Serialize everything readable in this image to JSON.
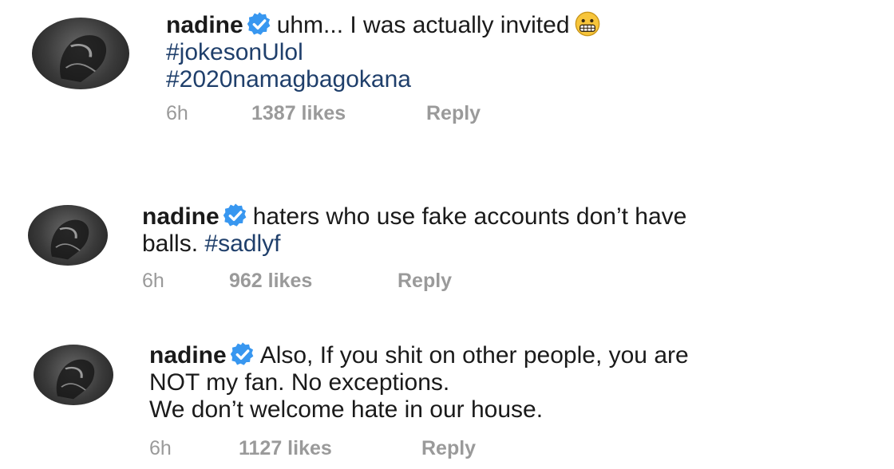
{
  "comments": [
    {
      "username": "nadine",
      "text_line1": "uhm... I was actually invited",
      "emoji": "grimacing-face-emoji",
      "hashtag1": "#jokesonUlol",
      "hashtag2": "#2020namagbagokana",
      "time": "6h",
      "likes": "1387 likes",
      "reply": "Reply"
    },
    {
      "username": "nadine",
      "text_line1": "haters who use fake accounts don’t have",
      "text_line2": "balls.",
      "hashtag": "#sadlyf",
      "time": "6h",
      "likes": "962 likes",
      "reply": "Reply"
    },
    {
      "username": "nadine",
      "text_line1": "Also, If you shit on other people, you are",
      "text_line2": "NOT my fan. No exceptions.",
      "text_line3": "We don’t welcome hate in our house.",
      "time": "6h",
      "likes": "1127 likes",
      "reply": "Reply"
    }
  ],
  "icons": {
    "verified": "verified-badge-icon",
    "avatar": "profile-avatar"
  },
  "colors": {
    "hashtag": "#1f3f6b",
    "verified": "#3897f0",
    "meta": "#9a9a9a"
  }
}
